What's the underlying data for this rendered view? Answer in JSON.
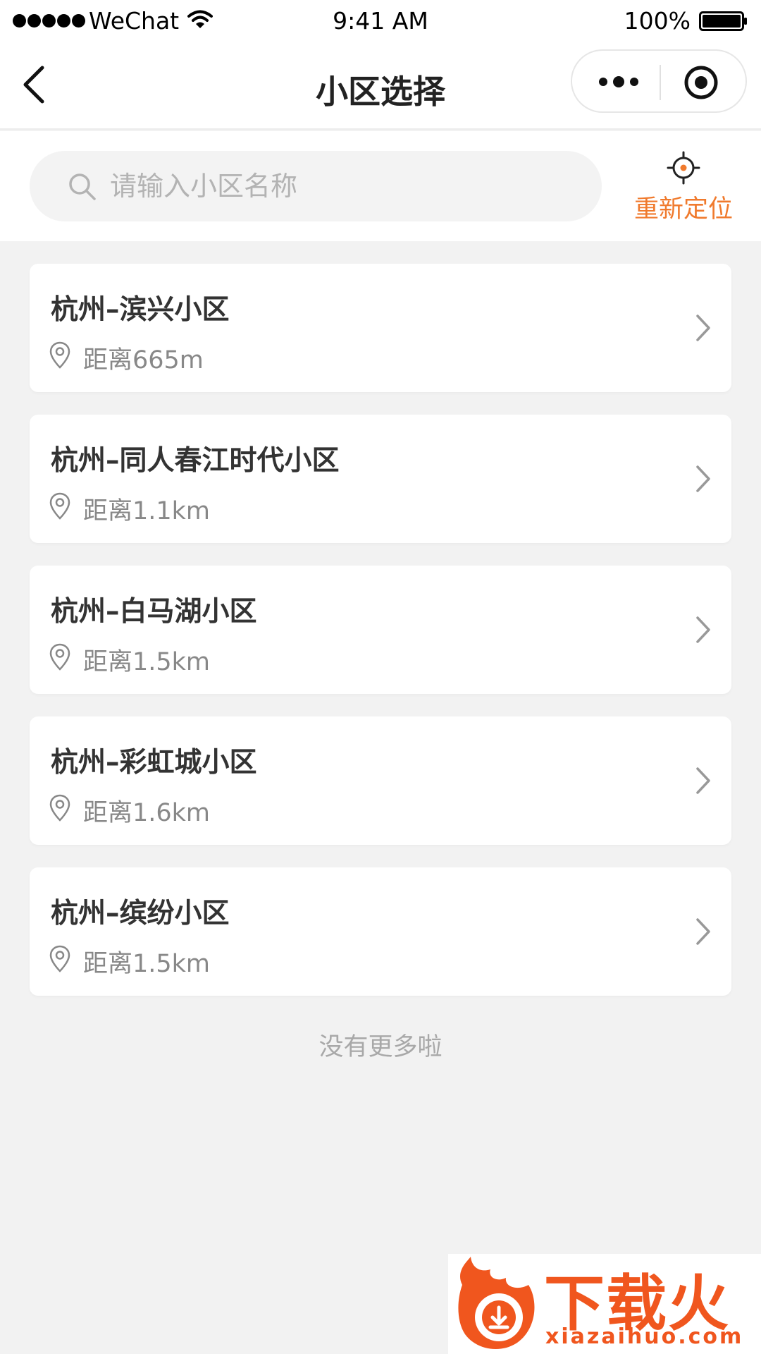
{
  "status_bar": {
    "carrier": "WeChat",
    "time": "9:41 AM",
    "battery": "100%"
  },
  "nav": {
    "title": "小区选择"
  },
  "search": {
    "placeholder": "请输入小区名称",
    "value": ""
  },
  "relocate": {
    "label": "重新定位"
  },
  "communities": [
    {
      "name": "杭州–滨兴小区",
      "distance": "距离665m"
    },
    {
      "name": "杭州–同人春江时代小区",
      "distance": "距离1.1km"
    },
    {
      "name": "杭州–白马湖小区",
      "distance": "距离1.5km"
    },
    {
      "name": "杭州–彩虹城小区",
      "distance": "距离1.6km"
    },
    {
      "name": "杭州–缤纷小区",
      "distance": "距离1.5km"
    }
  ],
  "footer": {
    "no_more": "没有更多啦"
  },
  "watermark": {
    "brand": "下载火",
    "url": "xiazaihuo.com"
  },
  "colors": {
    "accent": "#f07a2d",
    "brand": "#f0561e"
  }
}
